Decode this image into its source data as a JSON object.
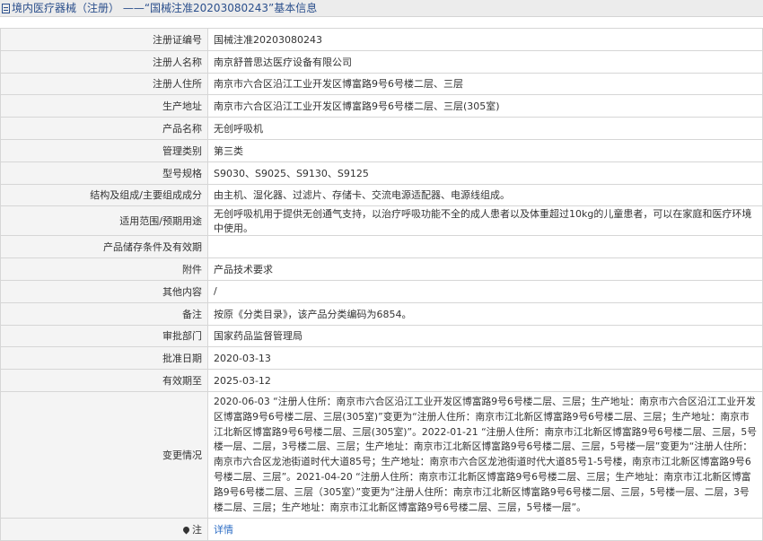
{
  "header": {
    "title": "境内医疗器械（注册） ——“国械注准20203080243”基本信息"
  },
  "rows": [
    {
      "label": "注册证编号",
      "value": "国械注准20203080243"
    },
    {
      "label": "注册人名称",
      "value": "南京舒普思达医疗设备有限公司"
    },
    {
      "label": "注册人住所",
      "value": "南京市六合区沿江工业开发区博富路9号6号楼二层、三层"
    },
    {
      "label": "生产地址",
      "value": "南京市六合区沿江工业开发区博富路9号6号楼二层、三层(305室)"
    },
    {
      "label": "产品名称",
      "value": "无创呼吸机"
    },
    {
      "label": "管理类别",
      "value": "第三类"
    },
    {
      "label": "型号规格",
      "value": "S9030、S9025、S9130、S9125"
    },
    {
      "label": "结构及组成/主要组成成分",
      "value": "由主机、湿化器、过滤片、存储卡、交流电源适配器、电源线组成。"
    },
    {
      "label": "适用范围/预期用途",
      "value": "无创呼吸机用于提供无创通气支持，以治疗呼吸功能不全的成人患者以及体重超过10kg的儿童患者，可以在家庭和医疗环境中使用。"
    },
    {
      "label": "产品储存条件及有效期",
      "value": ""
    },
    {
      "label": "附件",
      "value": "产品技术要求"
    },
    {
      "label": "其他内容",
      "value": "/"
    },
    {
      "label": "备注",
      "value": "按原《分类目录》，该产品分类编码为6854。"
    },
    {
      "label": "审批部门",
      "value": "国家药品监督管理局"
    },
    {
      "label": "批准日期",
      "value": "2020-03-13"
    },
    {
      "label": "有效期至",
      "value": "2025-03-12"
    },
    {
      "label": "变更情况",
      "value": "2020-06-03 “注册人住所：南京市六合区沿江工业开发区博富路9号6号楼二层、三层；生产地址：南京市六合区沿江工业开发区博富路9号6号楼二层、三层(305室)”变更为“注册人住所：南京市江北新区博富路9号6号楼二层、三层；生产地址：南京市江北新区博富路9号6号楼二层、三层(305室)”。2022-01-21 “注册人住所：南京市江北新区博富路9号6号楼二层、三层，5号楼一层、二层，3号楼二层、三层；生产地址：南京市江北新区博富路9号6号楼二层、三层，5号楼一层”变更为“注册人住所：南京市六合区龙池街道时代大道85号；生产地址：南京市六合区龙池街道时代大道85号1-5号楼，南京市江北新区博富路9号6号楼二层、三层”。2021-04-20 “注册人住所：南京市江北新区博富路9号6号楼二层、三层；生产地址：南京市江北新区博富路9号6号楼二层、三层（305室）”变更为“注册人住所：南京市江北新区博富路9号6号楼二层、三层，5号楼一层、二层，3号楼二层、三层；生产地址：南京市江北新区博富路9号6号楼二层、三层，5号楼一层”。"
    }
  ],
  "note": {
    "label": "注",
    "link": "详情",
    "icon": "map-pin-icon"
  }
}
